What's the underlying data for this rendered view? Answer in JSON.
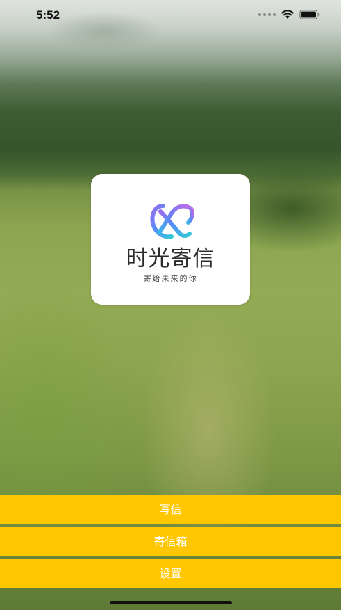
{
  "status_bar": {
    "time": "5:52",
    "icons": [
      "signal-dots-icon",
      "wifi-icon",
      "battery-icon"
    ]
  },
  "app": {
    "name": "时光寄信",
    "slogan": "寄给未来的你",
    "logo_icon": "stylized-x-logo-icon"
  },
  "menu": {
    "write_label": "写信",
    "mailbox_label": "寄信箱",
    "settings_label": "设置"
  },
  "colors": {
    "button_background": "#ffc700",
    "button_text": "#ffffff",
    "logo_gradient_start": "#4f8ff7",
    "logo_gradient_mid": "#9a6cf0",
    "logo_gradient_end": "#33c9d9"
  }
}
